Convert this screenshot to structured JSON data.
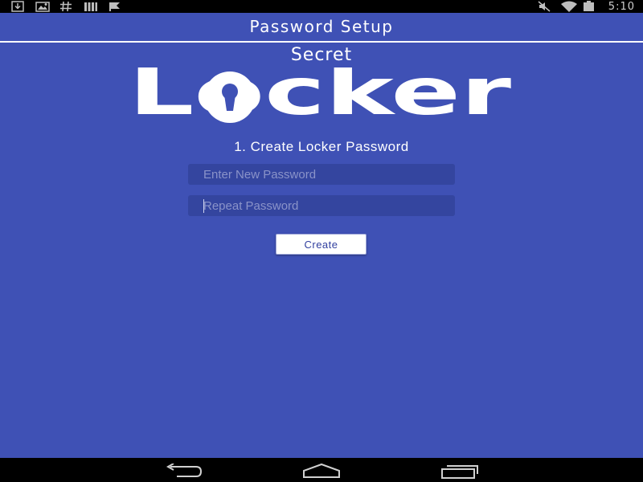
{
  "status_bar": {
    "time": "5:10",
    "left_icons": [
      "download-icon",
      "image-icon",
      "hash-icon",
      "bars-icon",
      "flag-icon"
    ],
    "right_icons": [
      "mute-icon",
      "wifi-icon",
      "battery-icon"
    ]
  },
  "app_bar": {
    "title": "Password Setup"
  },
  "logo": {
    "secret": "Secret",
    "locker": "Locker"
  },
  "form": {
    "heading": "1. Create Locker Password",
    "new_password_placeholder": "Enter New Password",
    "repeat_password_placeholder": "Repeat Password",
    "create_label": "Create"
  },
  "nav_bar": {
    "icons": [
      "back-icon",
      "home-icon",
      "recent-apps-icon"
    ]
  },
  "colors": {
    "primary": "#3F51B5",
    "field_bg": "#34459f",
    "text": "#ffffff"
  }
}
